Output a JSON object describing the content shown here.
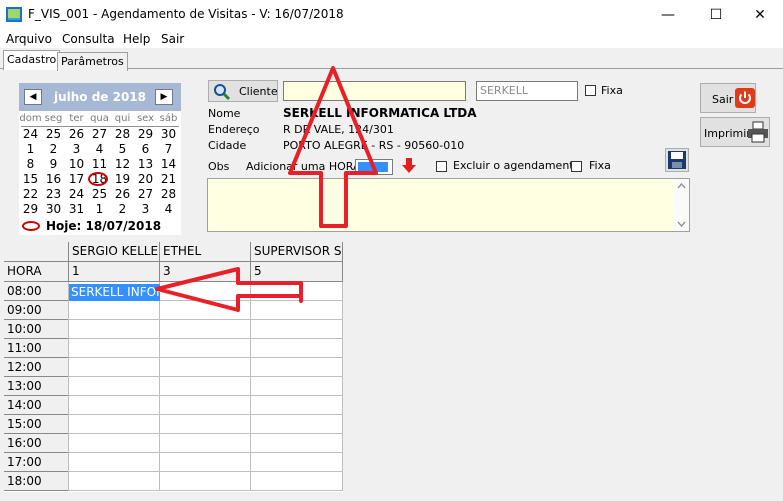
{
  "window": {
    "title": "F_VIS_001 - Agendamento de Visitas - V: 16/07/2018",
    "minimize": "—",
    "maximize": "☐",
    "close": "✕"
  },
  "menu": [
    "Arquivo",
    "Consulta",
    "Help",
    "Sair"
  ],
  "tabs": [
    "Cadastro",
    "Parâmetros"
  ],
  "calendar": {
    "month": "julho de 2018",
    "prev": "◀",
    "next": "▶",
    "weekdays": [
      "dom",
      "seg",
      "ter",
      "qua",
      "qui",
      "sex",
      "sáb"
    ],
    "weeks": [
      [
        "24",
        "25",
        "26",
        "27",
        "28",
        "29",
        "30"
      ],
      [
        "1",
        "2",
        "3",
        "4",
        "5",
        "6",
        "7"
      ],
      [
        "8",
        "9",
        "10",
        "11",
        "12",
        "13",
        "14"
      ],
      [
        "15",
        "16",
        "17",
        "18",
        "19",
        "20",
        "21"
      ],
      [
        "22",
        "23",
        "24",
        "25",
        "26",
        "27",
        "28"
      ],
      [
        "29",
        "30",
        "31",
        "1",
        "2",
        "3",
        "4"
      ]
    ],
    "today_label": "Hoje: 18/07/2018"
  },
  "form": {
    "cliente_button": "Cliente",
    "client_code": "SERKELL",
    "fixa": "Fixa",
    "nome_label": "Nome",
    "nome_value": "SERKELL INFORMATICA LTDA",
    "endereco_label": "Endereço",
    "endereco_value": "R DR VALE, 124/301",
    "cidade_label": "Cidade",
    "cidade_value": "PORTO ALEGRE - RS - 90560-010",
    "obs_label": "Obs",
    "adicionar_label": "Adicionar uma HORA",
    "excluir_label": "Excluir o agendamento",
    "fixa2": "Fixa",
    "sair_button": "Sair",
    "imprimir_button": "Imprimir"
  },
  "grid": {
    "columns": [
      "SERGIO KELLER",
      "ETHEL",
      "SUPERVISOR SE"
    ],
    "hora_label": "HORA",
    "codes": [
      "1",
      "3",
      "5"
    ],
    "hours": [
      "08:00",
      "09:00",
      "10:00",
      "11:00",
      "12:00",
      "13:00",
      "14:00",
      "15:00",
      "16:00",
      "17:00",
      "18:00"
    ],
    "appointment": "SERKELL INFORMATICA"
  },
  "colors": {
    "annotation": "#e8202a",
    "selection": "#3390ff",
    "input_bg": "#ffffe1"
  }
}
